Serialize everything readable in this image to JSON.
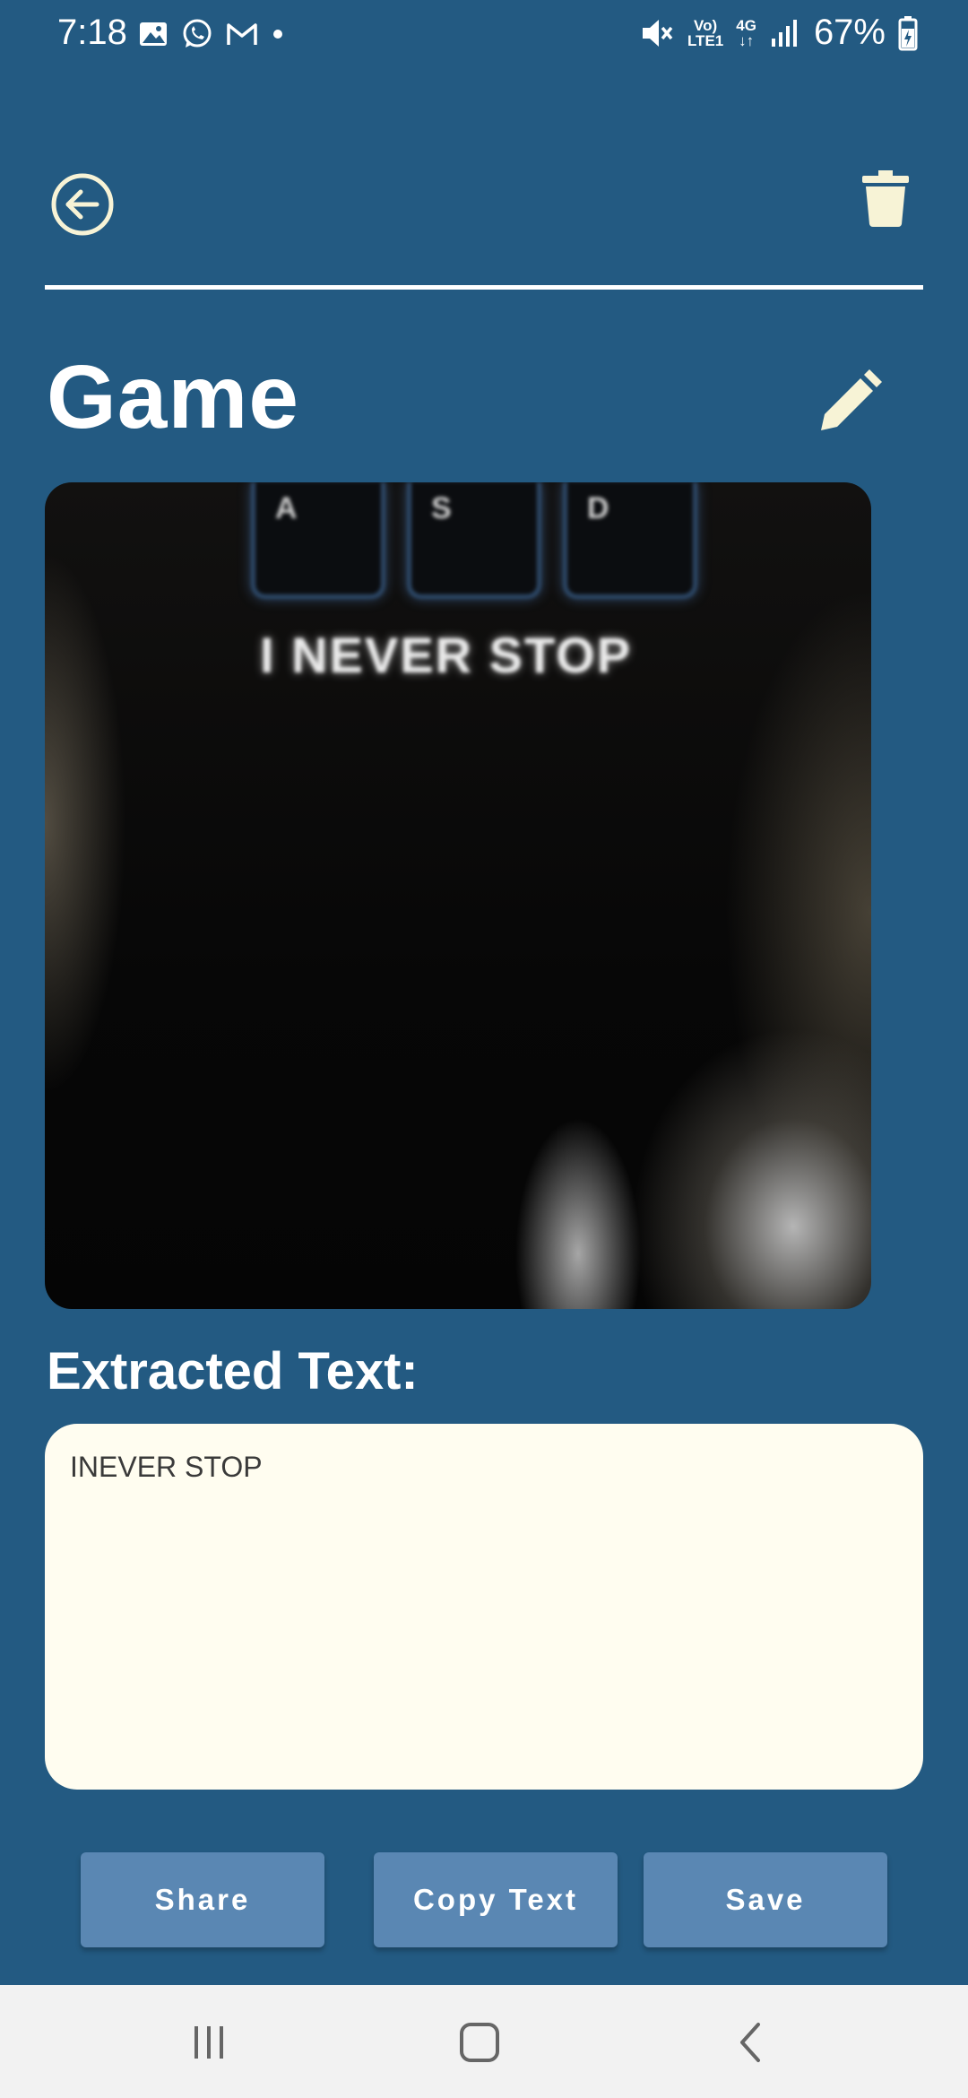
{
  "status_bar": {
    "time": "7:18",
    "network_top": "Vo)",
    "network_bottom": "LTE1",
    "net_type": "4G",
    "battery": "67%",
    "icons": [
      "image-icon",
      "whatsapp-icon",
      "gmail-icon",
      "dot-icon",
      "mute-icon",
      "signal-icon",
      "battery-icon"
    ]
  },
  "header": {
    "back_icon": "back-arrow-circle-icon",
    "delete_icon": "trash-icon"
  },
  "note": {
    "title": "Game",
    "edit_icon": "pencil-icon",
    "image": {
      "key_labels": [
        "A",
        "S",
        "D"
      ],
      "caption": "I NEVER STOP"
    },
    "extracted_label": "Extracted Text:",
    "extracted_text": "INEVER STOP"
  },
  "actions": {
    "share": "Share",
    "copy": "Copy Text",
    "save": "Save"
  },
  "nav": {
    "icons": [
      "recents-icon",
      "home-icon",
      "back-icon"
    ]
  },
  "colors": {
    "background": "#235a82",
    "button": "#5a87b3",
    "text_box": "#fffdf0",
    "icon_cream": "#f7f3d6"
  }
}
